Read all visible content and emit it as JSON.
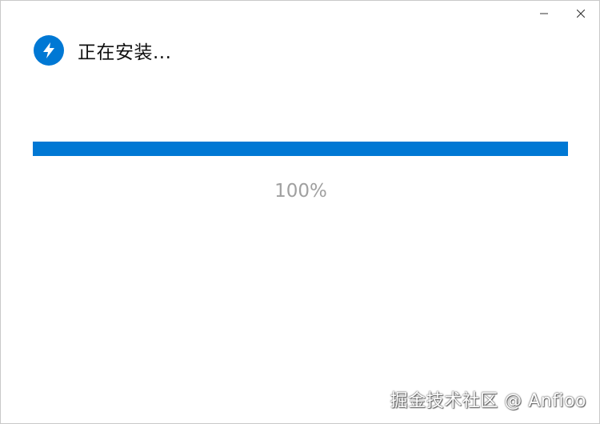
{
  "window": {
    "title": "正在安装...",
    "minimize_icon": "minimize-icon",
    "close_icon": "close-icon"
  },
  "app": {
    "icon": "lightning-icon",
    "accent_color": "#0078d4"
  },
  "progress": {
    "value_percent": 100,
    "label": "100%",
    "fill_color": "#0078d4"
  },
  "watermark": {
    "text": "掘金技术社区 @ Anfioo"
  }
}
